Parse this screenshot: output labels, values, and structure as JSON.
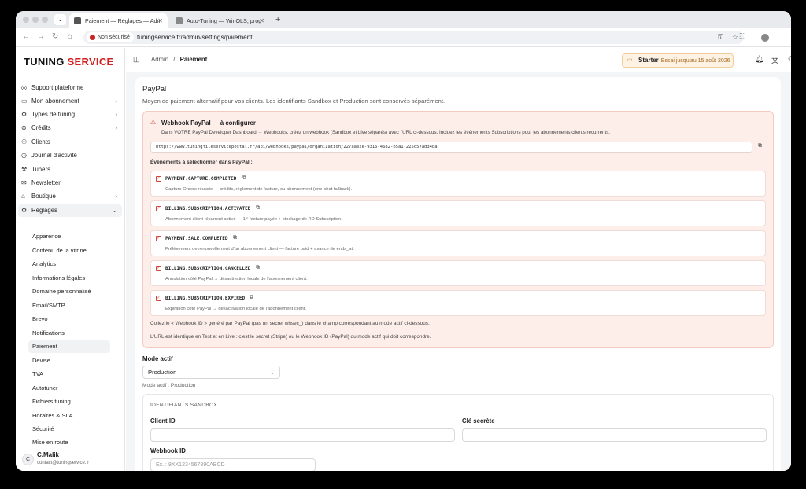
{
  "browser": {
    "tabs": [
      {
        "label": "Paiement — Réglages — Adm"
      },
      {
        "label": "Auto-Tuning — WinOLS, prog"
      }
    ],
    "security_label": "Non sécurisé",
    "url": "tuningservice.fr/admin/settings/paiement"
  },
  "sidebar": {
    "logo_a": "TUNING",
    "logo_b": "SERVICE",
    "items": [
      {
        "label": "Support plateforme",
        "icon": "headset-icon"
      },
      {
        "label": "Mon abonnement",
        "icon": "card-icon"
      },
      {
        "label": "Types de tuning",
        "icon": "gear-icon"
      },
      {
        "label": "Crédits",
        "icon": "coins-icon"
      },
      {
        "label": "Clients",
        "icon": "users-icon"
      },
      {
        "label": "Journal d'activité",
        "icon": "history-icon"
      },
      {
        "label": "Tuners",
        "icon": "wrench-icon"
      },
      {
        "label": "Newsletter",
        "icon": "mail-icon"
      },
      {
        "label": "Boutique",
        "icon": "shop-icon"
      },
      {
        "label": "Réglages",
        "icon": "settings-icon"
      }
    ],
    "sub_items": [
      "Apparence",
      "Contenu de la vitrine",
      "Analytics",
      "Informations légales",
      "Domaine personnalisé",
      "Email/SMTP",
      "Brevo",
      "Notifications",
      "Paiement",
      "Devise",
      "TVA",
      "Autotuner",
      "Fichiers tuning",
      "Horaires & SLA",
      "Sécurité",
      "Mise en route"
    ],
    "user": {
      "initial": "C",
      "name": "C.Malik",
      "email": "contact@tuningservice.fr"
    }
  },
  "header": {
    "breadcrumb_root": "Admin",
    "breadcrumb_sep": "/",
    "breadcrumb_current": "Paiement",
    "plan_name": "Starter",
    "plan_note": "Essai jusqu'au 15 août 2026"
  },
  "paypal": {
    "title": "PayPal",
    "description": "Moyen de paiement alternatif pour vos clients. Les identifiants Sandbox et Production sont conservés séparément.",
    "webhook_title": "Webhook PayPal — à configurer",
    "webhook_desc": "Dans VOTRE PayPal Developer Dashboard → Webhooks, créez un webhook (Sandbox et Live séparés) avec l'URL ci-dessous. Incluez les événements Subscriptions pour les abonnements clients récurrents.",
    "webhook_url": "https://www.tuningfileservicepostal.fr/api/webhooks/paypal/organization/227aae2e-9316-4682-b5a1-225d57ad34ba",
    "events_label": "Événements à sélectionner dans PayPal :",
    "events": [
      {
        "code": "PAYMENT.CAPTURE.COMPLETED",
        "desc": "Capture Orders réussie — crédits, règlement de facture, ou abonnement (one-shot fallback)."
      },
      {
        "code": "BILLING.SUBSCRIPTION.ACTIVATED",
        "desc": "Abonnement client récurrent activé — 1ʳᵉ facture payée + stockage de l'ID Subscription."
      },
      {
        "code": "PAYMENT.SALE.COMPLETED",
        "desc": "Prélèvement de renouvellement d'un abonnement client — facture paid + avance de ends_at."
      },
      {
        "code": "BILLING.SUBSCRIPTION.CANCELLED",
        "desc": "Annulation côté PayPal → désactivation locale de l'abonnement client."
      },
      {
        "code": "BILLING.SUBSCRIPTION.EXPIRED",
        "desc": "Expiration côté PayPal → désactivation locale de l'abonnement client."
      }
    ],
    "note_1": "Collez le « Webhook ID » généré par PayPal (pas un secret whsec_) dans le champ correspondant au mode actif ci-dessous.",
    "note_2": "L'URL est identique en Test et en Live : c'est le secret (Stripe) ou le Webhook ID (PayPal) du mode actif qui doit correspondre.",
    "mode_label": "Mode actif",
    "mode_value": "Production",
    "mode_hint": "Mode actif : Production",
    "sandbox": {
      "title": "IDENTIFIANTS SANDBOX",
      "client_id_label": "Client ID",
      "client_id_value": "",
      "secret_label": "Clé secrète",
      "secret_value": "",
      "webhook_label": "Webhook ID",
      "webhook_placeholder": "Ex. : 8XX1234567890ABCD"
    }
  }
}
